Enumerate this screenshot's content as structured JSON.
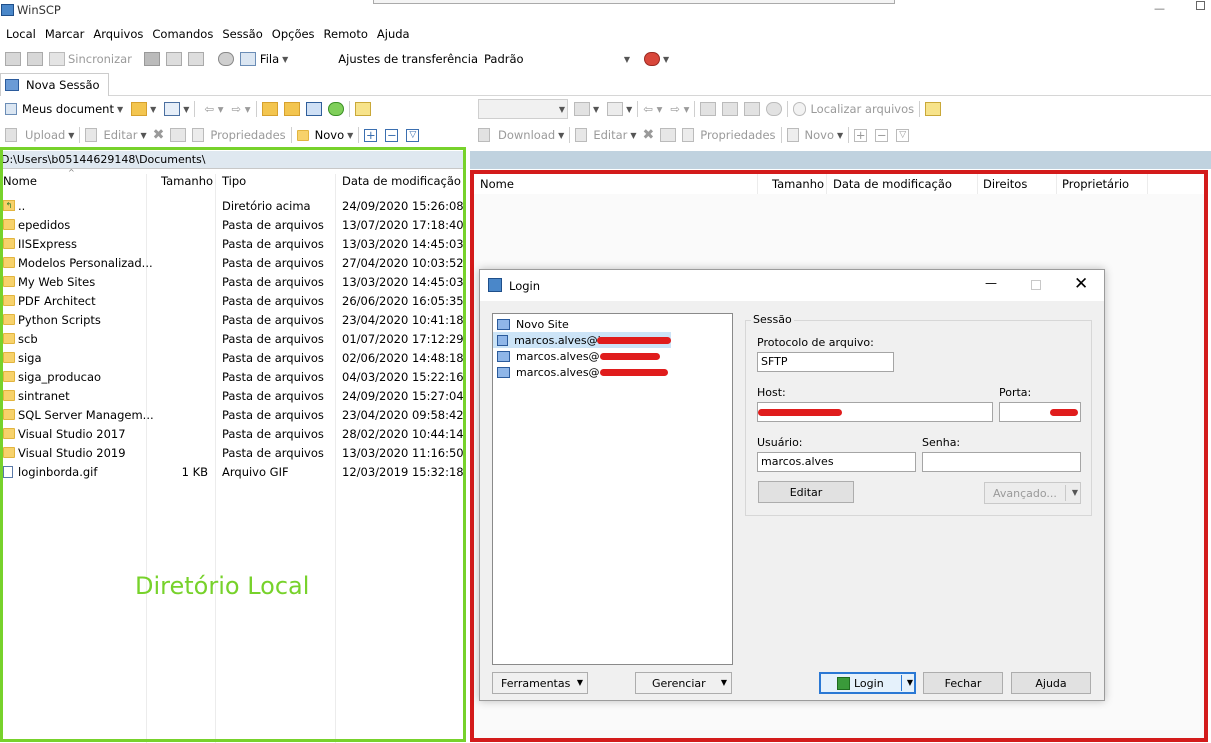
{
  "window": {
    "title": "WinSCP"
  },
  "menu": [
    "Local",
    "Marcar",
    "Arquivos",
    "Comandos",
    "Sessão",
    "Opções",
    "Remoto",
    "Ajuda"
  ],
  "toolbar": {
    "sync_label": "Sincronizar",
    "queue_label": "Fila",
    "transfer_settings_label": "Ajustes de transferência",
    "transfer_settings_value": "Padrão"
  },
  "tabs": {
    "new_session": "Nova Sessão"
  },
  "local": {
    "location": "Meus document",
    "toolbar": {
      "upload": "Upload",
      "edit": "Editar",
      "properties": "Propriedades",
      "new": "Novo"
    },
    "path": "D:\\Users\\b05144629148\\Documents\\",
    "columns": {
      "name": "Nome",
      "size": "Tamanho",
      "type": "Tipo",
      "modified": "Data de modificação"
    },
    "files": [
      {
        "name": "..",
        "size": "",
        "type": "Diretório acima",
        "modified": "24/09/2020  15:26:08"
      },
      {
        "name": "epedidos",
        "size": "",
        "type": "Pasta de arquivos",
        "modified": "13/07/2020  17:18:40"
      },
      {
        "name": "IISExpress",
        "size": "",
        "type": "Pasta de arquivos",
        "modified": "13/03/2020  14:45:03"
      },
      {
        "name": "Modelos Personalizad...",
        "size": "",
        "type": "Pasta de arquivos",
        "modified": "27/04/2020  10:03:52"
      },
      {
        "name": "My Web Sites",
        "size": "",
        "type": "Pasta de arquivos",
        "modified": "13/03/2020  14:45:03"
      },
      {
        "name": "PDF Architect",
        "size": "",
        "type": "Pasta de arquivos",
        "modified": "26/06/2020  16:05:35"
      },
      {
        "name": "Python Scripts",
        "size": "",
        "type": "Pasta de arquivos",
        "modified": "23/04/2020  10:41:18"
      },
      {
        "name": "scb",
        "size": "",
        "type": "Pasta de arquivos",
        "modified": "01/07/2020  17:12:29"
      },
      {
        "name": "siga",
        "size": "",
        "type": "Pasta de arquivos",
        "modified": "02/06/2020  14:48:18"
      },
      {
        "name": "siga_producao",
        "size": "",
        "type": "Pasta de arquivos",
        "modified": "04/03/2020  15:22:16"
      },
      {
        "name": "sintranet",
        "size": "",
        "type": "Pasta de arquivos",
        "modified": "24/09/2020  15:27:04"
      },
      {
        "name": "SQL Server Managem...",
        "size": "",
        "type": "Pasta de arquivos",
        "modified": "23/04/2020  09:58:42"
      },
      {
        "name": "Visual Studio 2017",
        "size": "",
        "type": "Pasta de arquivos",
        "modified": "28/02/2020  10:44:14"
      },
      {
        "name": "Visual Studio 2019",
        "size": "",
        "type": "Pasta de arquivos",
        "modified": "13/03/2020  11:16:50"
      },
      {
        "name": "loginborda.gif",
        "size": "1 KB",
        "type": "Arquivo GIF",
        "modified": "12/03/2019  15:32:18"
      }
    ],
    "annotation": "Diretório Local"
  },
  "remote": {
    "toolbar": {
      "find_files": "Localizar arquivos",
      "download": "Download",
      "edit": "Editar",
      "properties": "Propriedades",
      "new": "Novo"
    },
    "columns": {
      "name": "Nome",
      "size": "Tamanho",
      "modified": "Data de modificação",
      "rights": "Direitos",
      "owner": "Proprietário"
    }
  },
  "login_dialog": {
    "title": "Login",
    "sites": [
      "Novo Site",
      "marcos.alves@i",
      "marcos.alves@",
      "marcos.alves@"
    ],
    "session_group": "Sessão",
    "protocol_label": "Protocolo de arquivo:",
    "protocol_value": "SFTP",
    "host_label": "Host:",
    "port_label": "Porta:",
    "user_label": "Usuário:",
    "user_value": "marcos.alves",
    "password_label": "Senha:",
    "edit_button": "Editar",
    "advanced_button": "Avançado...",
    "tools_button": "Ferramentas",
    "manage_button": "Gerenciar",
    "login_button": "Login",
    "close_button": "Fechar",
    "help_button": "Ajuda"
  },
  "colors": {
    "local_highlight": "#77d22b",
    "remote_highlight": "#d31b1b",
    "redaction": "#e01c1c"
  }
}
